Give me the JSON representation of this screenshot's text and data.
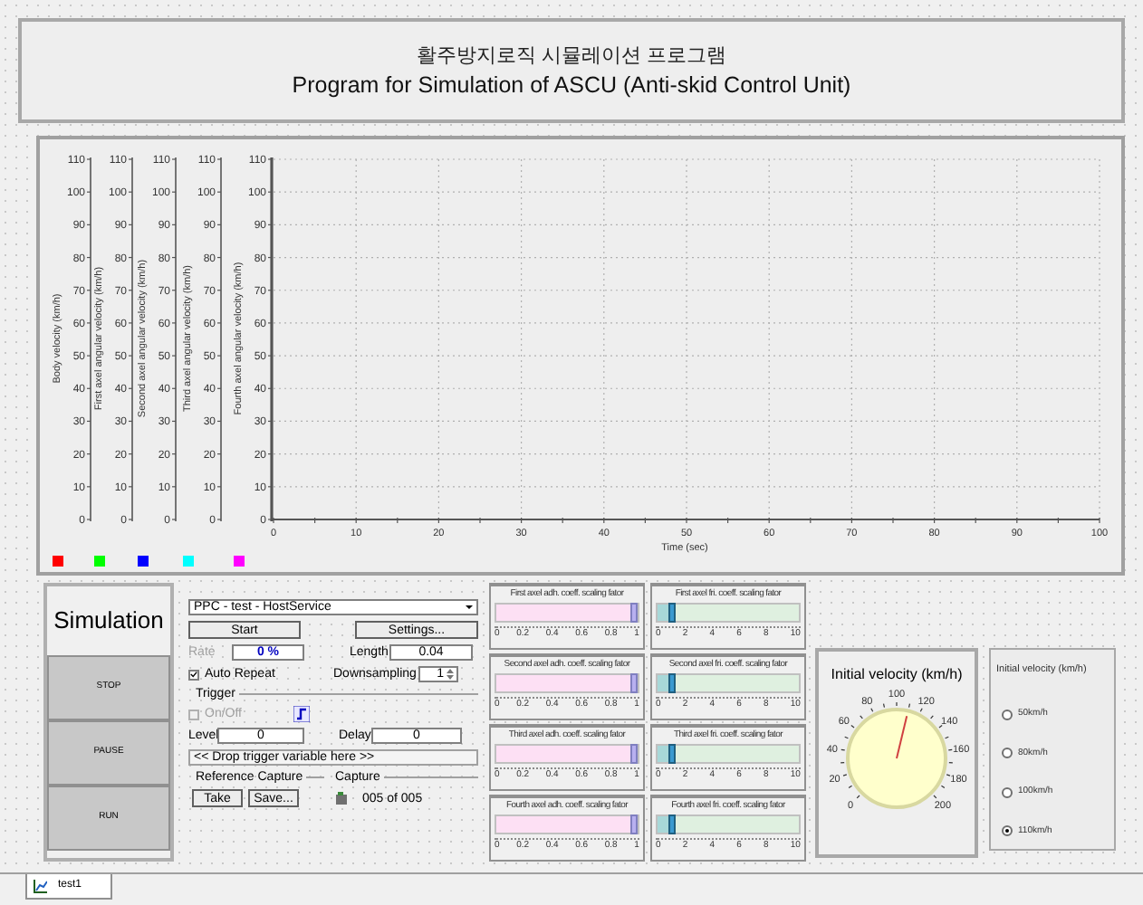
{
  "header": {
    "title_ko": "활주방지로직 시뮬레이션 프로그램",
    "title_en": "Program for Simulation of ASCU (Anti-skid Control Unit)"
  },
  "plot": {
    "y_axes": [
      {
        "label": "Body velocity (km/h)",
        "color": "#ff0000",
        "ticks": [
          "110",
          "100",
          "90",
          "80",
          "70",
          "60",
          "50",
          "40",
          "30",
          "20",
          "10",
          "0"
        ]
      },
      {
        "label": "First axel angular velocity (km/h)",
        "color": "#00ff00",
        "ticks": [
          "110",
          "100",
          "90",
          "80",
          "70",
          "60",
          "50",
          "40",
          "30",
          "20",
          "10",
          "0"
        ]
      },
      {
        "label": "Second axel angular velocity (km/h)",
        "color": "#0000ff",
        "ticks": [
          "110",
          "100",
          "90",
          "80",
          "70",
          "60",
          "50",
          "40",
          "30",
          "20",
          "10",
          "0"
        ]
      },
      {
        "label": "Third axel angular velocity (km/h)",
        "color": "#00ffff",
        "ticks": [
          "110",
          "100",
          "90",
          "80",
          "70",
          "60",
          "50",
          "40",
          "30",
          "20",
          "10",
          "0"
        ]
      },
      {
        "label": "Fourth axel angular velocity (km/h)",
        "color": "#ff00ff",
        "ticks": [
          "110",
          "100",
          "90",
          "80",
          "70",
          "60",
          "50",
          "40",
          "30",
          "20",
          "10",
          "0"
        ]
      }
    ],
    "x_ticks": [
      "0",
      "10",
      "20",
      "30",
      "40",
      "50",
      "60",
      "70",
      "80",
      "90",
      "100"
    ],
    "x_label": "Time (sec)"
  },
  "simulation": {
    "title": "Simulation",
    "buttons": [
      "STOP",
      "PAUSE",
      "RUN"
    ]
  },
  "control": {
    "source": "PPC - test - HostService",
    "start": "Start",
    "settings": "Settings...",
    "rate_label": {
      "text": "Rate",
      "disabled": true
    },
    "rate": "0 %",
    "length_label": "Length",
    "length": "0.04",
    "auto_repeat": {
      "label": "Auto Repeat",
      "checked": true
    },
    "downsampling_label": "Downsampling",
    "downsampling": "1",
    "trigger": {
      "title": "Trigger",
      "on_off": {
        "label": "On/Off",
        "checked": false,
        "disabled": true
      },
      "level_label": "Level",
      "trigger_level": "0",
      "delay_label": "Delay",
      "delay": "0"
    },
    "drop_zone": "<< Drop trigger variable here >>",
    "reference_capture": {
      "title": "Reference Capture",
      "buttons": [
        "Take",
        "Save..."
      ]
    },
    "capture": {
      "title": "Capture",
      "count": "005 of 005"
    }
  },
  "sliders": [
    {
      "title": "First axel adh. coeff. scaling fator",
      "kind": "adh",
      "level": 0.97,
      "ticks": [
        "0",
        "0.2",
        "0.4",
        "0.6",
        "0.8",
        "1"
      ]
    },
    {
      "title": "First axel fri. coeff. scaling fator",
      "kind": "fri",
      "level": 0.1,
      "ticks": [
        "0",
        "2",
        "4",
        "6",
        "8",
        "10"
      ]
    },
    {
      "title": "Second axel adh. coeff. scaling fator",
      "kind": "adh",
      "level": 0.97,
      "ticks": [
        "0",
        "0.2",
        "0.4",
        "0.6",
        "0.8",
        "1"
      ]
    },
    {
      "title": "Second axel fri. coeff. scaling fator",
      "kind": "fri",
      "level": 0.1,
      "ticks": [
        "0",
        "2",
        "4",
        "6",
        "8",
        "10"
      ]
    },
    {
      "title": "Third axel adh. coeff. scaling fator",
      "kind": "adh",
      "level": 0.97,
      "ticks": [
        "0",
        "0.2",
        "0.4",
        "0.6",
        "0.8",
        "1"
      ]
    },
    {
      "title": "Third axel fri. coeff. scaling fator",
      "kind": "fri",
      "level": 0.1,
      "ticks": [
        "0",
        "2",
        "4",
        "6",
        "8",
        "10"
      ]
    },
    {
      "title": "Fourth axel adh. coeff. scaling fator",
      "kind": "adh",
      "level": 0.97,
      "ticks": [
        "0",
        "0.2",
        "0.4",
        "0.6",
        "0.8",
        "1"
      ]
    },
    {
      "title": "Fourth axel fri. coeff. scaling fator",
      "kind": "fri",
      "level": 0.1,
      "ticks": [
        "0",
        "2",
        "4",
        "6",
        "8",
        "10"
      ]
    }
  ],
  "gauge": {
    "title": "Initial velocity (km/h)",
    "ticks": [
      "0",
      "20",
      "40",
      "60",
      "80",
      "100",
      "120",
      "140",
      "160",
      "180",
      "200"
    ],
    "level": 0.55
  },
  "radio": {
    "title": "Initial velocity (km/h)",
    "options": [
      {
        "label": "50km/h",
        "selected": false
      },
      {
        "label": "80km/h",
        "selected": false
      },
      {
        "label": "100km/h",
        "selected": false
      },
      {
        "label": "110km/h",
        "selected": true
      }
    ]
  },
  "tabs": [
    {
      "label": "test1",
      "selected": true
    }
  ]
}
